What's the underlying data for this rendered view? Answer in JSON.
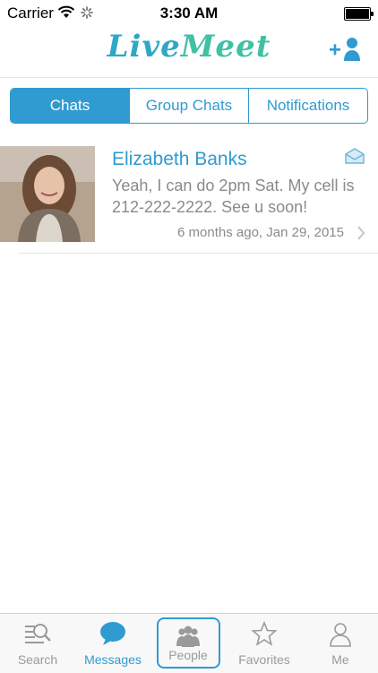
{
  "status_bar": {
    "carrier": "Carrier",
    "time": "3:30 AM"
  },
  "header": {
    "logo_part1": "Live",
    "logo_part2": "Meet",
    "add_user_icon": "add-user-icon"
  },
  "segments": [
    {
      "label": "Chats",
      "active": true
    },
    {
      "label": "Group Chats",
      "active": false
    },
    {
      "label": "Notifications",
      "active": false
    }
  ],
  "chats": [
    {
      "name": "Elizabeth Banks",
      "message": "Yeah, I can do 2pm Sat. My cell is 212-222-2222. See u soon!",
      "time": "6 months ago, Jan 29, 2015",
      "icon": "mail-icon"
    }
  ],
  "tabbar": [
    {
      "label": "Search",
      "icon": "search-icon",
      "active": false
    },
    {
      "label": "Messages",
      "icon": "chat-bubble-icon",
      "active": true
    },
    {
      "label": "People",
      "icon": "people-icon",
      "active": false
    },
    {
      "label": "Favorites",
      "icon": "star-icon",
      "active": false
    },
    {
      "label": "Me",
      "icon": "person-icon",
      "active": false
    }
  ],
  "colors": {
    "accent": "#2f9bd1",
    "logo_live": "#2fa8c6",
    "logo_meet": "#3fc1a4",
    "muted_text": "#8a8a8a"
  }
}
